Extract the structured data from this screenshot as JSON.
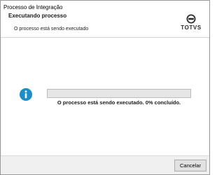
{
  "window": {
    "title": "Processo de Integração"
  },
  "header": {
    "title": "Executando processo",
    "subtitle": "O processo está sendo executado",
    "logo_text": "TOTVS"
  },
  "progress": {
    "percent": 0,
    "status_text": "O processo está sendo executado. 0% concluído."
  },
  "footer": {
    "cancel_label": "Cancelar"
  },
  "colors": {
    "info_icon": "#1b8fc9",
    "progress_track": "#e6e6e6",
    "button_face": "#e1e1e1"
  },
  "icons": {
    "info": "info-icon",
    "logo": "totvs-logo-icon"
  }
}
